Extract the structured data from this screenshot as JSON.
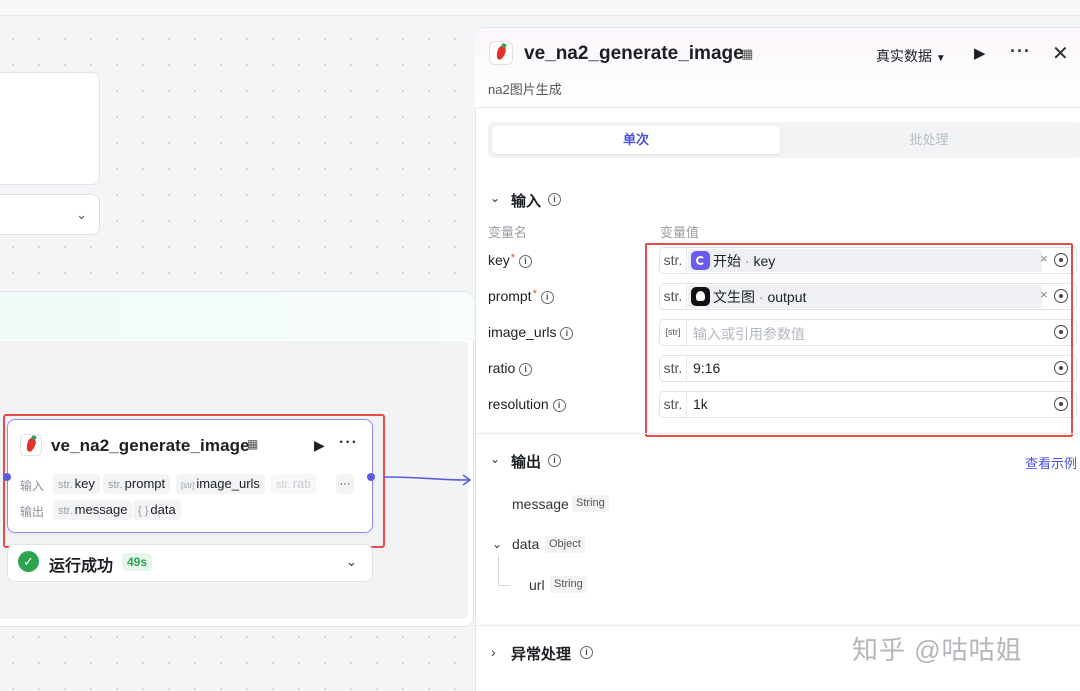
{
  "node": {
    "title": "ve_na2_generate_image",
    "input_label": "输入",
    "output_label": "输出",
    "inputs": [
      {
        "type": "str.",
        "name": "key"
      },
      {
        "type": "str.",
        "name": "prompt"
      },
      {
        "type": "[str]",
        "name": "image_urls"
      },
      {
        "type": "str.",
        "name": "rati"
      }
    ],
    "outputs": [
      {
        "type": "str.",
        "name": "message"
      },
      {
        "type": "{ }",
        "name": "data"
      }
    ],
    "more_label": "···"
  },
  "run_status": {
    "text": "运行成功",
    "duration": "49s"
  },
  "panel": {
    "title": "ve_na2_generate_image",
    "subtitle": "na2图片生成",
    "data_mode": "真实数据",
    "tabs": {
      "single": "单次",
      "batch": "批处理"
    },
    "input_section": {
      "title": "输入",
      "col_name": "变量名",
      "col_value": "变量值",
      "params": [
        {
          "name": "key",
          "required": true,
          "type": "str.",
          "ref_source": "开始",
          "ref_field": "key"
        },
        {
          "name": "prompt",
          "required": true,
          "type": "str.",
          "ref_source": "文生图",
          "ref_field": "output"
        },
        {
          "name": "image_urls",
          "required": false,
          "type": "[str]",
          "placeholder": "输入或引用参数值"
        },
        {
          "name": "ratio",
          "required": false,
          "type": "str.",
          "value": "9:16"
        },
        {
          "name": "resolution",
          "required": false,
          "type": "str.",
          "value": "1k"
        }
      ]
    },
    "output_section": {
      "title": "输出",
      "view_example": "查看示例",
      "fields": [
        {
          "name": "message",
          "type": "String"
        },
        {
          "name": "data",
          "type": "Object"
        },
        {
          "name": "url",
          "type": "String"
        }
      ]
    },
    "error_section": {
      "title": "异常处理"
    }
  },
  "watermark": "知乎 @咕咕姐",
  "colors": {
    "accent": "#4b51e0",
    "success": "#2da44e",
    "highlight": "#e94b4b"
  }
}
